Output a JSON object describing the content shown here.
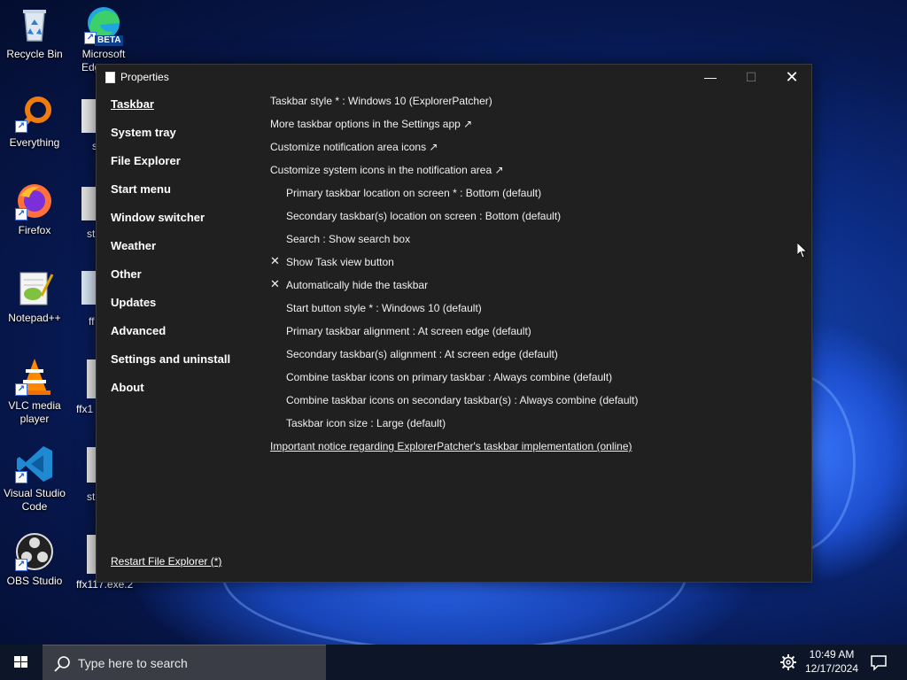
{
  "window": {
    "title": "Properties",
    "minimize_glyph": "—",
    "maximize_glyph": "☐",
    "close_glyph": "✕"
  },
  "nav": {
    "items": [
      {
        "label": "Taskbar",
        "active": true
      },
      {
        "label": "System tray",
        "active": false
      },
      {
        "label": "File Explorer",
        "active": false
      },
      {
        "label": "Start menu",
        "active": false
      },
      {
        "label": "Window switcher",
        "active": false
      },
      {
        "label": "Weather",
        "active": false
      },
      {
        "label": "Other",
        "active": false
      },
      {
        "label": "Updates",
        "active": false
      },
      {
        "label": "Advanced",
        "active": false
      },
      {
        "label": "Settings and uninstall",
        "active": false
      },
      {
        "label": "About",
        "active": false
      }
    ],
    "restart_label": "Restart File Explorer (*)"
  },
  "content": {
    "rows": [
      {
        "text": "Taskbar style * : Windows 10 (ExplorerPatcher)",
        "indent": false,
        "check": false,
        "link": false
      },
      {
        "text": "More taskbar options in the Settings app ↗",
        "indent": false,
        "check": false,
        "link": false
      },
      {
        "text": "Customize notification area icons ↗",
        "indent": false,
        "check": false,
        "link": false
      },
      {
        "text": "Customize system icons in the notification area ↗",
        "indent": false,
        "check": false,
        "link": false
      },
      {
        "text": "Primary taskbar location on screen * : Bottom (default)",
        "indent": true,
        "check": false,
        "link": false
      },
      {
        "text": "Secondary taskbar(s) location on screen : Bottom (default)",
        "indent": true,
        "check": false,
        "link": false
      },
      {
        "text": "Search : Show search box",
        "indent": true,
        "check": false,
        "link": false
      },
      {
        "text": "Show Task view button",
        "indent": true,
        "check": true,
        "link": false
      },
      {
        "text": "Automatically hide the taskbar",
        "indent": true,
        "check": true,
        "link": false
      },
      {
        "text": "Start button style * : Windows 10 (default)",
        "indent": true,
        "check": false,
        "link": false
      },
      {
        "text": "Primary taskbar alignment : At screen edge (default)",
        "indent": true,
        "check": false,
        "link": false
      },
      {
        "text": "Secondary taskbar(s) alignment : At screen edge (default)",
        "indent": true,
        "check": false,
        "link": false
      },
      {
        "text": "Combine taskbar icons on primary taskbar : Always combine (default)",
        "indent": true,
        "check": false,
        "link": false
      },
      {
        "text": "Combine taskbar icons on secondary taskbar(s) : Always combine (default)",
        "indent": true,
        "check": false,
        "link": false
      },
      {
        "text": "Taskbar icon size : Large (default)",
        "indent": true,
        "check": false,
        "link": false
      },
      {
        "text": "Important notice regarding ExplorerPatcher's taskbar implementation (online)",
        "indent": false,
        "check": false,
        "link": true
      }
    ],
    "check_glyph": "✕"
  },
  "desktop": {
    "icons": [
      {
        "label": "Recycle Bin",
        "icon": "recycle-bin-icon"
      },
      {
        "label": "Everything",
        "icon": "everything-icon"
      },
      {
        "label": "Firefox",
        "icon": "firefox-icon"
      },
      {
        "label": "Notepad++",
        "icon": "notepad-plus-plus-icon"
      },
      {
        "label": "VLC media player",
        "icon": "vlc-icon"
      },
      {
        "label": "Visual Studio Code",
        "icon": "vscode-icon"
      },
      {
        "label": "OBS Studio",
        "icon": "obs-icon"
      }
    ],
    "edge_label_1": "Microsoft",
    "edge_label_2": "Edg",
    "edge_badge": "BETA",
    "partial_labels": [
      "s",
      "st",
      "ff",
      "ffx1",
      "st",
      "ffx117.exe.2"
    ]
  },
  "taskbar": {
    "search_placeholder": "Type here to search",
    "time": "10:49 AM",
    "date": "12/17/2024"
  },
  "colors": {
    "window_bg": "#202020",
    "taskbar_bg": "#0d1629",
    "search_bg": "#3a3d45"
  }
}
